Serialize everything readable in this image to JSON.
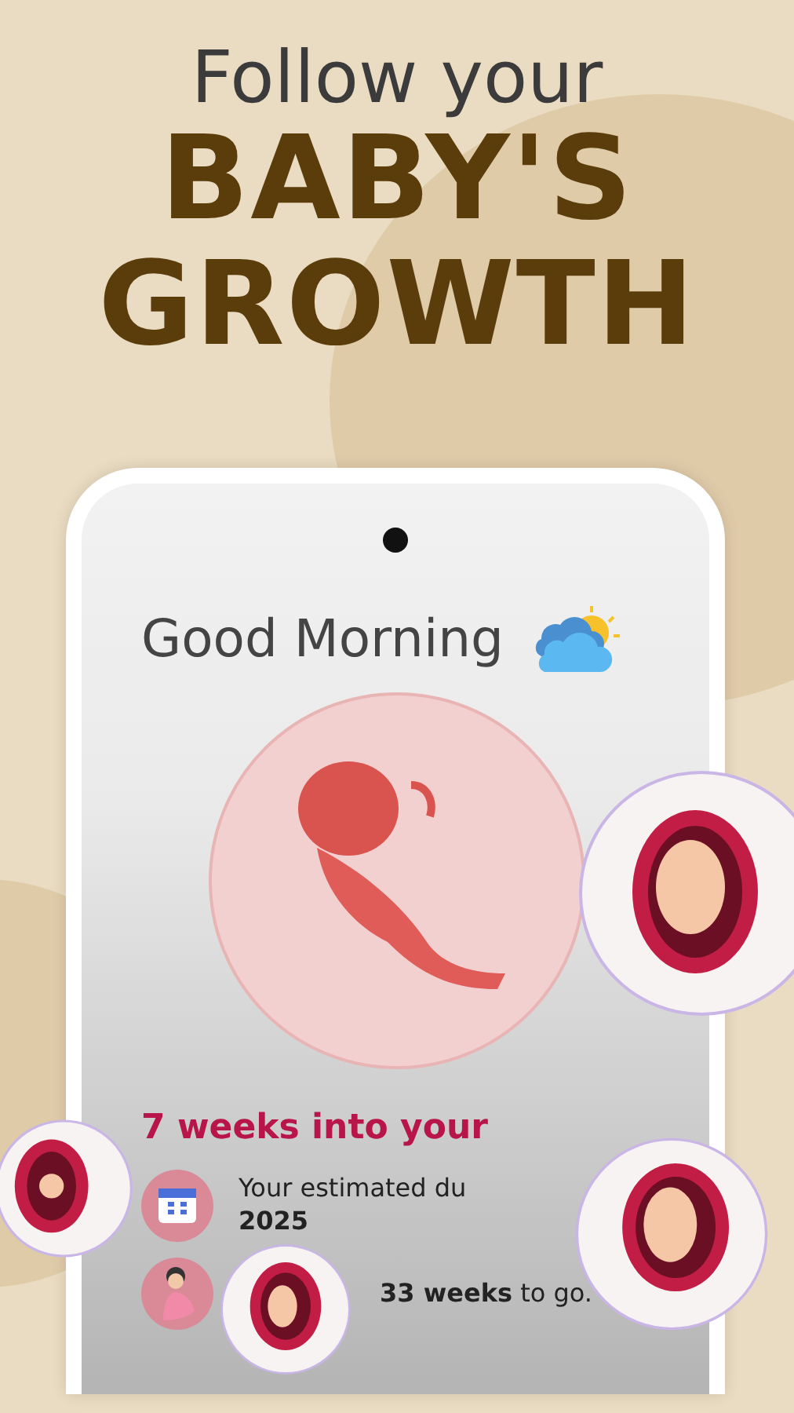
{
  "headline": {
    "line_1": "Follow your",
    "line_2": "BABY'S",
    "line_3": "GROWTH"
  },
  "phone_screen": {
    "greeting": "Good Morning",
    "progress_title": "7 weeks into your",
    "due_label": "Your estimated du",
    "due_date": "2025",
    "weeks_left": "**33 weeks** to go."
  }
}
